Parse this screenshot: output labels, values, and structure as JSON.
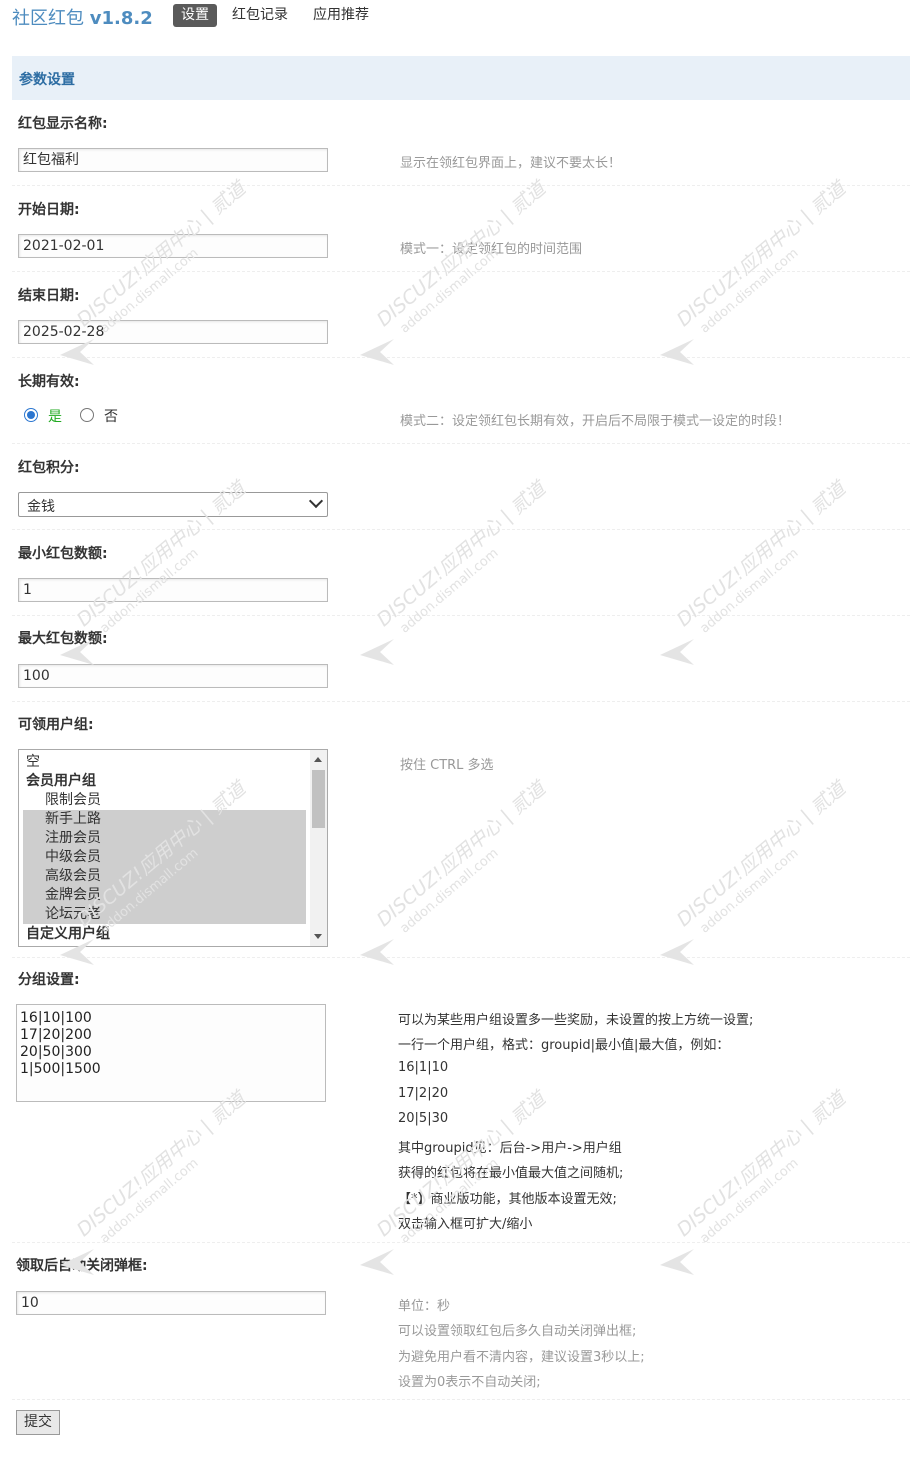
{
  "header": {
    "app_name": "社区红包",
    "version": "v1.8.2",
    "tabs": [
      {
        "label": "设置",
        "active": true
      },
      {
        "label": "红包记录",
        "active": false
      },
      {
        "label": "应用推荐",
        "active": false
      }
    ]
  },
  "section": {
    "title": "参数设置"
  },
  "fields": {
    "display_name": {
      "label": "红包显示名称:",
      "value": "红包福利",
      "hint": "显示在领红包界面上，建议不要太长！"
    },
    "start_date": {
      "label": "开始日期:",
      "value": "2021-02-01",
      "hint": "模式一：设定领红包的时间范围"
    },
    "end_date": {
      "label": "结束日期:",
      "value": "2025-02-28"
    },
    "long_term": {
      "label": "长期有效:",
      "yes": "是",
      "no": "否",
      "selected": "yes",
      "hint": "模式二：设定领红包长期有效，开启后不局限于模式一设定的时段！"
    },
    "credit": {
      "label": "红包积分:",
      "selected": "金钱"
    },
    "min_amount": {
      "label": "最小红包数额:",
      "value": "1"
    },
    "max_amount": {
      "label": "最大红包数额:",
      "value": "100"
    },
    "user_groups": {
      "label": "可领用户组:",
      "hint": "按住 CTRL 多选",
      "options": [
        {
          "label": "空",
          "type": "plain",
          "selected": false
        },
        {
          "label": "会员用户组",
          "type": "group",
          "selected": false
        },
        {
          "label": "限制会员",
          "type": "child",
          "selected": false
        },
        {
          "label": "新手上路",
          "type": "child",
          "selected": true
        },
        {
          "label": "注册会员",
          "type": "child",
          "selected": true
        },
        {
          "label": "中级会员",
          "type": "child",
          "selected": true
        },
        {
          "label": "高级会员",
          "type": "child",
          "selected": true
        },
        {
          "label": "金牌会员",
          "type": "child",
          "selected": true
        },
        {
          "label": "论坛元老",
          "type": "child",
          "selected": true
        },
        {
          "label": "自定义用户组",
          "type": "group",
          "selected": false
        }
      ]
    },
    "group_settings": {
      "label": "分组设置:",
      "lines": [
        "16|10|100",
        "17|20|200",
        "20|50|300",
        "1|500|1500"
      ],
      "hints": [
        "可以为某些用户组设置多一些奖励，未设置的按上方统一设置;",
        "一行一个用户组，格式：groupid|最小值|最大值，例如：",
        "16|1|10",
        "17|2|20",
        "20|5|30",
        "其中groupid见：后台->用户->用户组",
        "获得的红包将在最小值最大值之间随机;",
        "【*】商业版功能，其他版本设置无效;",
        "双击输入框可扩大/缩小"
      ]
    },
    "auto_close": {
      "label": "领取后自动关闭弹框:",
      "value": "10",
      "hints": [
        "单位：秒",
        "可以设置领取红包后多久自动关闭弹出框;",
        "为避免用户看不清内容，建议设置3秒以上;",
        "设置为0表示不自动关闭;"
      ]
    }
  },
  "submit_label": "提交",
  "watermark": {
    "brand": "DISCUZ!应用中心",
    "site": "addon.dismall.com",
    "tag": "贰道"
  },
  "colors": {
    "accent": "#4e8cbf",
    "header_bg": "#e8f0f8",
    "radio": "#2b76d0",
    "yes_label": "#22aa22"
  }
}
